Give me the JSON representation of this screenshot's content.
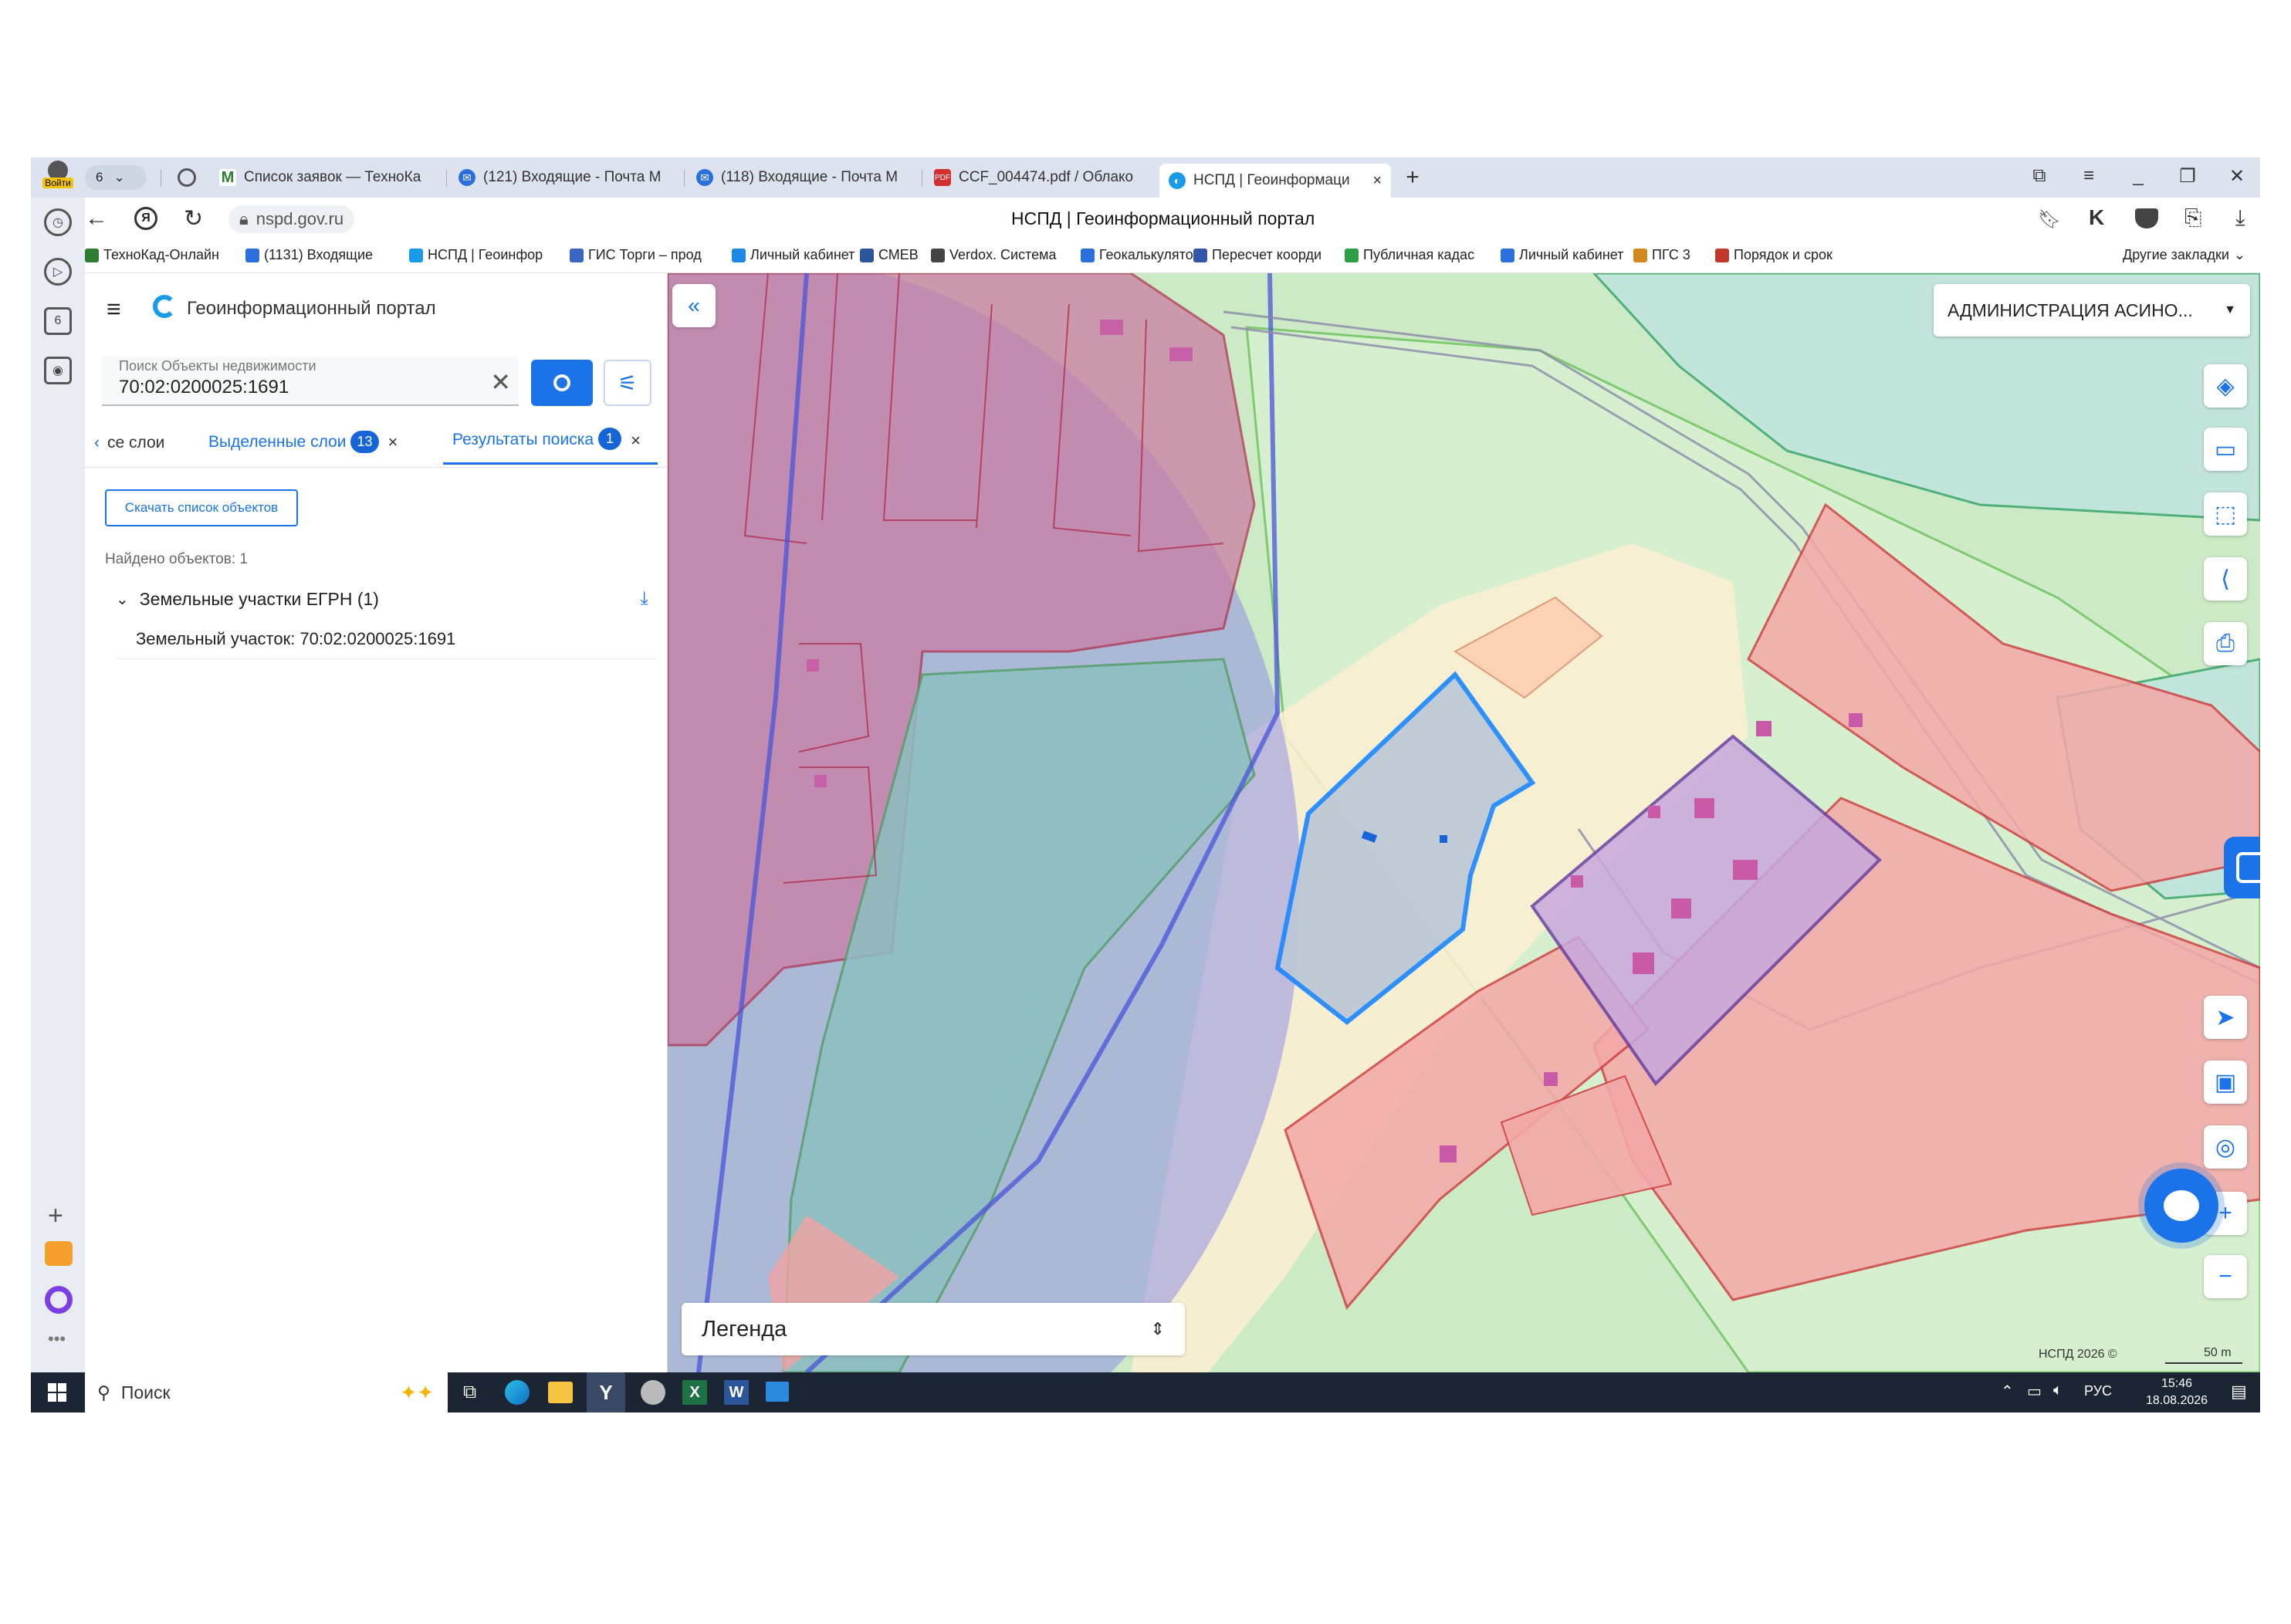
{
  "browser": {
    "profile_label": "Войти",
    "tab_count": "6",
    "tabs": [
      {
        "label": "Список заявок — ТехноКа",
        "icon": "gmail-icon"
      },
      {
        "label": "(121) Входящие - Почта М",
        "icon": "mail-icon"
      },
      {
        "label": "(118) Входящие - Почта М",
        "icon": "mail-icon"
      },
      {
        "label": "CCF_004474.pdf / Облако",
        "icon": "pdf-icon"
      },
      {
        "label": "НСПД | Геоинформаци",
        "icon": "nspd-icon"
      }
    ],
    "url": "nspd.gov.ru",
    "page_title": "НСПД | Геоинформационный портал",
    "bookmarks": [
      "ТехноКад-Онлайн",
      "(1131) Входящие",
      "НСПД | Геоинфор",
      "ГИС Торги – прод",
      "Личный кабинет",
      "СМЕВ",
      "Verdox. Система",
      "Геокалькулято",
      "Пересчет коорди",
      "Публичная кадас",
      "Личный кабинет",
      "ПГС 3",
      "Порядок и срок"
    ],
    "other_bookmarks": "Другие закладки"
  },
  "panel": {
    "app_title": "Геоинформационный портал",
    "search": {
      "label": "Поиск Объекты недвижимости",
      "value": "70:02:0200025:1691"
    },
    "tabs": [
      {
        "label": "се слои"
      },
      {
        "label": "Выделенные слои",
        "badge": "13"
      },
      {
        "label": "Результаты поиска",
        "badge": "1"
      }
    ],
    "download_button": "Скачать список объектов",
    "found_text": "Найдено объектов: 1",
    "group_label": "Земельные участки ЕГРН (1)",
    "result_item": "Земельный участок: 70:02:0200025:1691"
  },
  "map": {
    "region_select": "АДМИНИСТРАЦИЯ АСИНО...",
    "legend_label": "Легенда",
    "copyright": "НСПД 2026 ©",
    "scale": "50 m"
  },
  "taskbar": {
    "search_placeholder": "Поиск",
    "language": "РУС",
    "time": "15:46",
    "date": "18.08.2026"
  },
  "colors": {
    "accent": "#1a73e8",
    "badge": "#1565d8",
    "parcel_red": "#f08a8a",
    "parcel_purple": "#b58fcf",
    "green_zone": "#c9e9c3",
    "selected_outline": "#1e88ff"
  }
}
